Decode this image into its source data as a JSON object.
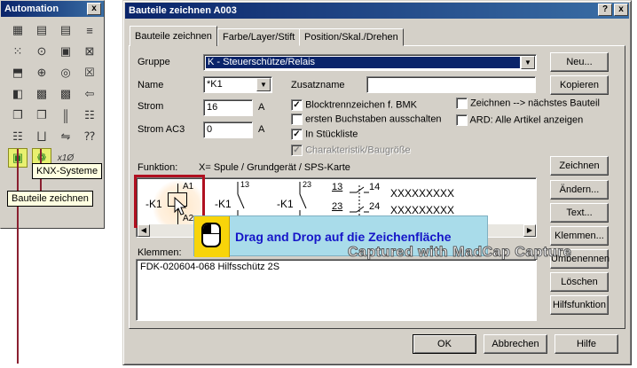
{
  "palette": {
    "title": "Automation",
    "close": "x",
    "tool_icons": [
      "grid-icon",
      "table-icon",
      "table-icon",
      "list-icon",
      "dots-icon",
      "circle-icon",
      "box-icon",
      "box-cross-icon",
      "box-arrow-icon",
      "pin-icon",
      "target-icon",
      "box-x-icon",
      "component-icon",
      "block-icon",
      "block-icon",
      "arrow-left-icon",
      "copy-icon",
      "copy-icon",
      "bus-icon",
      "rack-icon",
      "rack-icon",
      "relay-icon",
      "flip-icon",
      "question-icon",
      "bauteile-zeichnen-icon",
      "knx-systeme-icon",
      "x10-icon"
    ],
    "x10_label": "x1Ø",
    "tooltip_knx": "KNX-Systeme",
    "tooltip_bauteile": "Bauteile zeichnen"
  },
  "dialog": {
    "title": "Bauteile zeichnen  A003",
    "help": "?",
    "close": "x",
    "tabs": [
      "Bauteile zeichnen",
      "Farbe/Layer/Stift",
      "Position/Skal./Drehen"
    ],
    "gruppe_label": "Gruppe",
    "gruppe_value": "K - Steuerschütze/Relais",
    "name_label": "Name",
    "name_value": "*K1",
    "zusatzname_label": "Zusatzname",
    "zusatzname_value": "",
    "strom_label": "Strom",
    "strom_value": "16",
    "strom_unit": "A",
    "stromac3_label": "Strom AC3",
    "stromac3_value": "0",
    "stromac3_unit": "A",
    "check_blocktrenn": "Blocktrennzeichen f. BMK",
    "check_ersten": "ersten Buchstaben ausschalten",
    "check_stueckliste": "In Stückliste",
    "check_charakteristik": "Charakteristik/Baugröße",
    "check_zeichnen_naechstes": "Zeichnen --> nächstes Bauteil",
    "check_ard": "ARD: Alle Artikel anzeigen",
    "funktion_label": "Funktion:",
    "funktion_value": "X= Spule / Grundgerät / SPS-Karte",
    "preview": {
      "coil_label": "-K1",
      "coil_a1": "A1",
      "coil_a2": "A2",
      "c1_label": "-K1",
      "c1_num": "13",
      "c2_label": "-K1",
      "c2_num": "23",
      "c3_n1": "13",
      "c3_n2": "14",
      "c3_n3": "23",
      "c3_n4": "24",
      "x1": "XXXXXXXXX",
      "x2": "XXXXXXXXX"
    },
    "klemmen_label": "Klemmen:",
    "klemmen_value": "FDK-020604-068  Hilfsschütz 2S",
    "buttons": {
      "neu": "Neu...",
      "kopieren": "Kopieren",
      "zeichnen": "Zeichnen",
      "andern": "Ändern...",
      "text": "Text...",
      "klemmen": "Klemmen...",
      "umbenennen": "Umbenennen",
      "loeschen": "Löschen",
      "hilfsfunktion": "Hilfsfunktion",
      "ok": "OK",
      "abbrechen": "Abbrechen",
      "hilfe": "Hilfe"
    }
  },
  "callout": {
    "text": "Drag and Drop auf die Zeichenfläche"
  },
  "watermark": "Captured with MadCap Capture",
  "colors": {
    "titlebar": "#0a246a",
    "face": "#d4d0c8",
    "highlight_red": "#b01020",
    "callout_bg": "#a9dcea",
    "callout_text": "#1515c8",
    "selection": "#0a246a"
  }
}
